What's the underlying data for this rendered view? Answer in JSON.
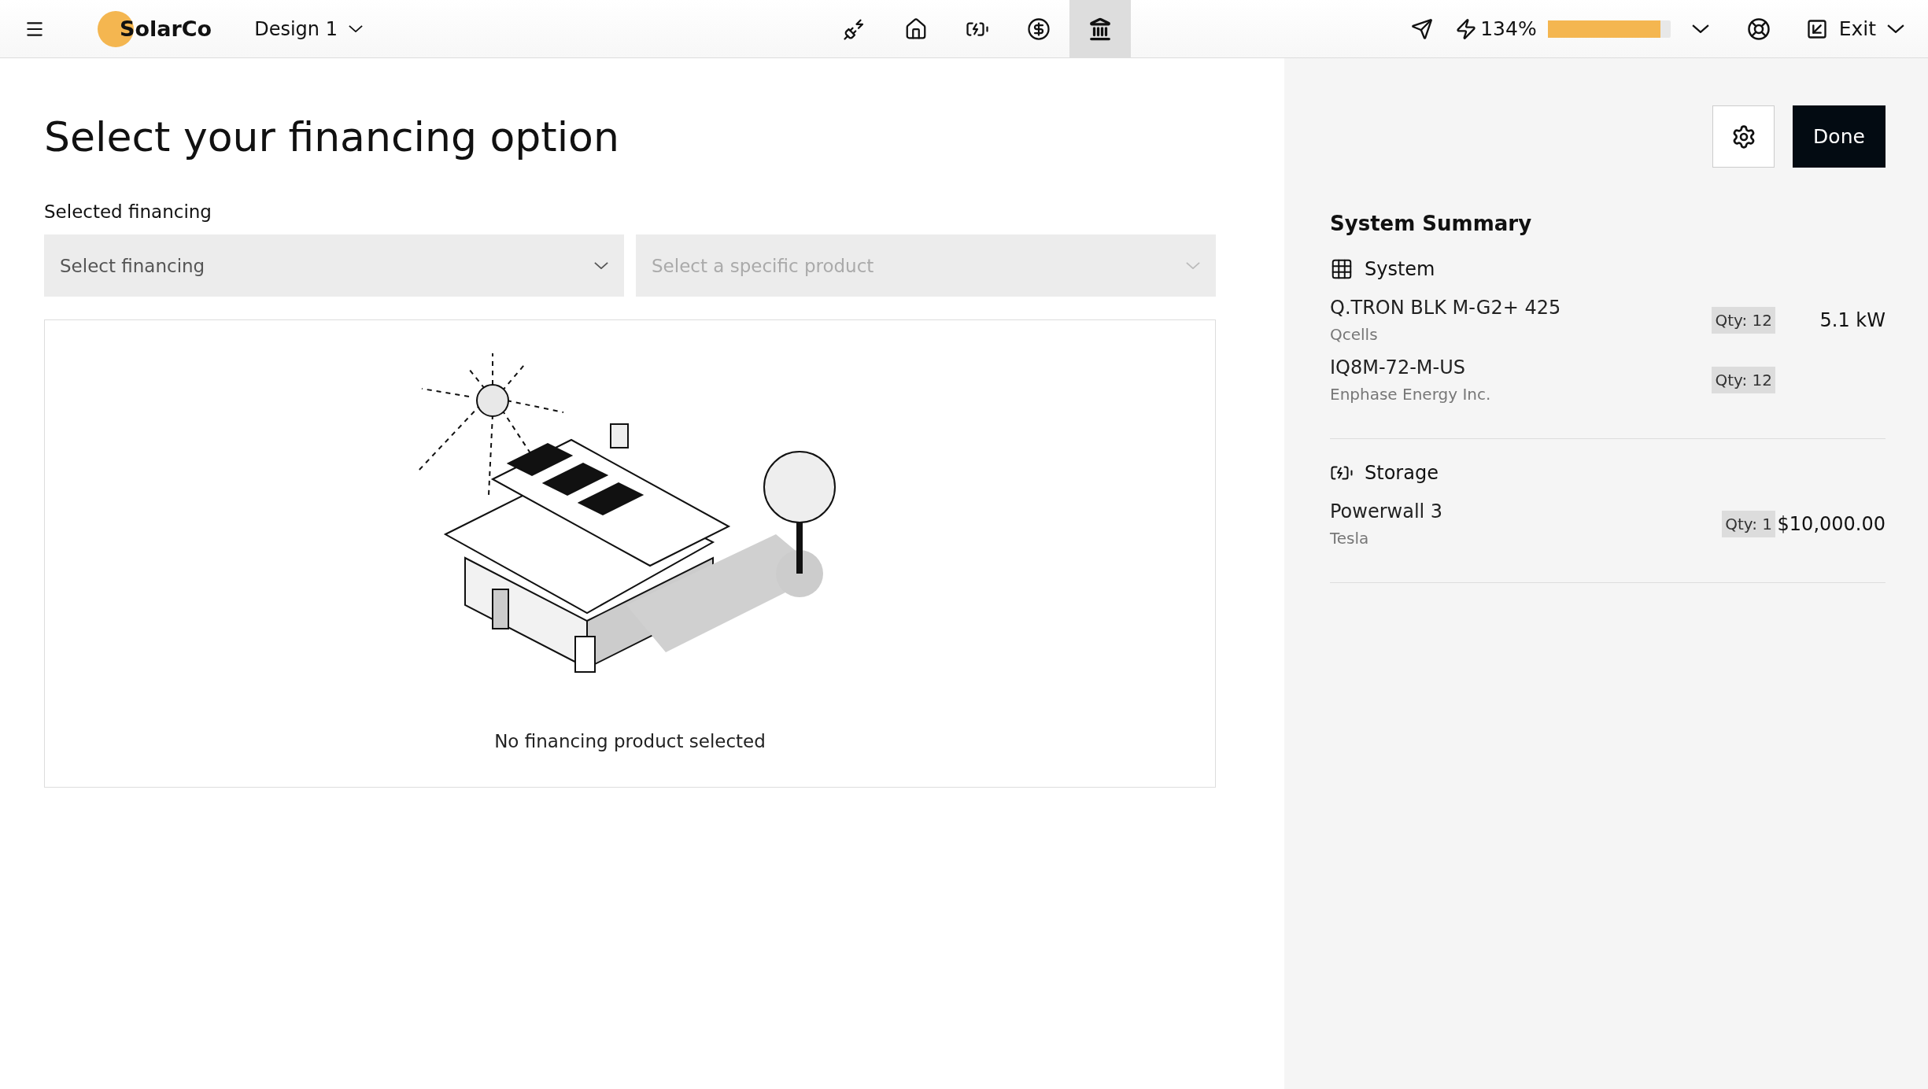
{
  "topbar": {
    "brand": "SolarCo",
    "design": "Design 1",
    "nav_tabs": [
      {
        "kind": "plug",
        "selected": false
      },
      {
        "kind": "home",
        "selected": false
      },
      {
        "kind": "battery",
        "selected": false
      },
      {
        "kind": "dollar",
        "selected": false
      },
      {
        "kind": "bank",
        "selected": true
      }
    ],
    "production": {
      "reading": "134%",
      "level": 0.92
    },
    "exit": "Exit"
  },
  "main": {
    "title": "Select your financing option",
    "field_label": "Selected financing",
    "selects": [
      {
        "placeholder": "Select financing",
        "disabled": false
      },
      {
        "placeholder": "Select a specific product",
        "disabled": true
      }
    ],
    "empty_text": "No financing product selected"
  },
  "summary": {
    "done": "Done",
    "title": "System Summary",
    "sections": [
      {
        "kind": "system",
        "title": "System",
        "items": [
          {
            "name": "Q.TRON BLK M-G2+ 425",
            "maker": "Qcells",
            "qty": "Qty: 12",
            "value": "5.1 kW"
          },
          {
            "name": "IQ8M-72-M-US",
            "maker": "Enphase Energy Inc.",
            "qty": "Qty: 12"
          }
        ]
      },
      {
        "kind": "storage",
        "title": "Storage",
        "items": [
          {
            "name": "Powerwall 3",
            "maker": "Tesla",
            "qty": "Qty: 1",
            "value": "$10,000.00"
          }
        ]
      }
    ]
  }
}
